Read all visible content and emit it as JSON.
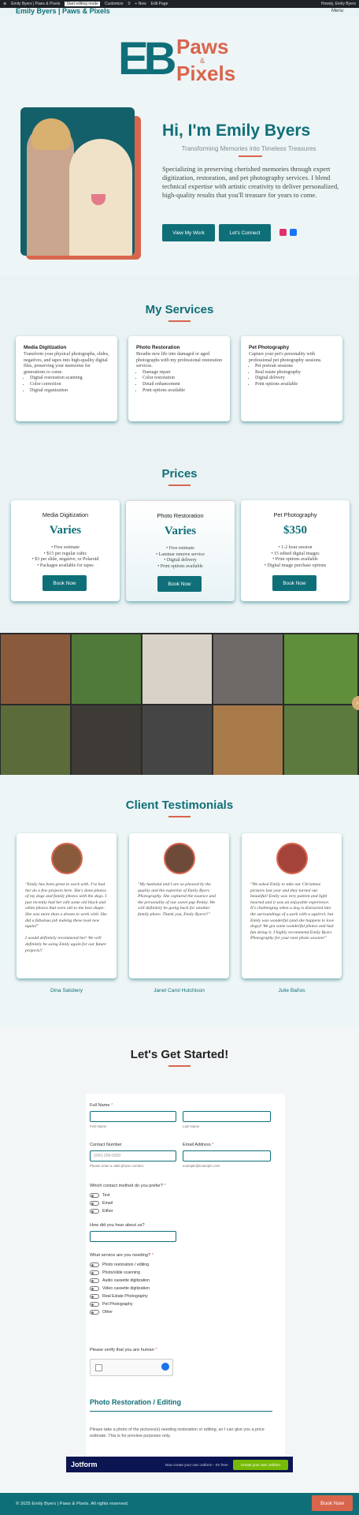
{
  "admin_bar": {
    "items": [
      "Emily Byers | Paws & Pixels",
      "Start editing mode",
      "Customize",
      "0",
      "+ New",
      "Edit Page"
    ],
    "account": "Howdy, Emily Byers"
  },
  "site": {
    "title": "Emily Byers | Paws & Pixels",
    "menu_label": "Menu"
  },
  "logo": {
    "initials": "EB",
    "word1": "Paws",
    "amp": "&",
    "word2": "Pixels"
  },
  "hero": {
    "heading": "Hi, I'm Emily Byers",
    "tagline": "Transforming Memories into Timeless Treasures",
    "intro": "Specializing in preserving cherished memories through expert digitization, restoration, and pet photography services. I blend technical expertise with artistic creativity to deliver personalized, high-quality results that you'll treasure for years to come.",
    "cta_primary": "View My Work",
    "cta_secondary": "Let's Connect",
    "social_icons": [
      "instagram-icon",
      "facebook-icon"
    ]
  },
  "services": {
    "title": "My Services",
    "cards": [
      {
        "name": "Media Digitization",
        "desc": "Transform your physical photographs, slides, negatives, and tapes into high-quality digital files, preserving your memories for generations to come.",
        "bullets": [
          "Digital restoration scanning",
          "Color correction",
          "Digital organization"
        ]
      },
      {
        "name": "Photo Restoration",
        "desc": "Breathe new life into damaged or aged photographs with my professional restoration services.",
        "bullets": [
          "Damage repair",
          "Color restoration",
          "Detail enhancement",
          "Print options available"
        ]
      },
      {
        "name": "Pet Photography",
        "desc": "Capture your pet's personality with professional pet photography sessions.",
        "bullets": [
          "Pet portrait sessions",
          "Real estate photography",
          "Digital delivery",
          "Print options available"
        ]
      }
    ]
  },
  "prices": {
    "title": "Prices",
    "cards": [
      {
        "name": "Media Digitization",
        "amount": "Varies",
        "bullets": [
          "Free estimate",
          "$15 per regular cubic",
          "$3 per slide, negative, or Polaroid",
          "Packages available for tapes"
        ],
        "button": "Book Now"
      },
      {
        "name": "Photo Restoration",
        "amount": "Varies",
        "bullets": [
          "Free estimate",
          "Laminar remove service",
          "Digital delivery",
          "Print options available"
        ],
        "button": "Book Now"
      },
      {
        "name": "Pet Photography",
        "amount": "$350",
        "bullets": [
          "1-2 hour session",
          "15 edited digital images",
          "Print options available",
          "Digital image purchase options"
        ],
        "button": "Book Now"
      }
    ]
  },
  "gallery": {
    "colors": [
      "#8a5a3c",
      "#4f7a3a",
      "#d9d2c8",
      "#6d6a68",
      "#5f8f3a",
      "#5c6b3a",
      "#3e3a36",
      "#454545",
      "#a87a4a",
      "#5c7a3e"
    ],
    "next_icon": "chevron-right-icon"
  },
  "testimonials": {
    "title": "Client Testimonials",
    "items": [
      {
        "quote": "\"Emily has been great to work with. I've had her do a few projects here. She's done photos of my dogs and family photos with the dogs. I just recently had her edit some old black and white photos that were old to the best shape. She was more than a dream to work with. She did a fabulous job making these look new again!\"",
        "note": "I would definitely recommend her! We will definitely be using Emily again for our future projects!!",
        "name": "Dina Salsbery"
      },
      {
        "quote": "\"My husband and I are so pleased by the quality and the expertise of Emily Byers Photography. She captured the essence and the personality of our sweet pup Penny. We will definitely be going back for another family photo. Thank you, Emily Byers!!\"",
        "note": "",
        "name": "Janet Carol Hutchison"
      },
      {
        "quote": "\"We asked Emily to take our Christmas pictures last year and they turned out beautiful! Emily was very patient and light hearted and it was an enjoyable experience. It's challenging when a dog is distracted into the surroundings of a park with a squirrel, but Emily was wonderful (and she happens to love dogs)! We got some wonderful photos and had fun doing it. I highly recommend Emily Byers Photography for your next photo session!\"",
        "note": "",
        "name": "Julie Baños"
      }
    ]
  },
  "form": {
    "title": "Let's Get Started!",
    "full_name_label": "Full Name",
    "first_name_sub": "First Name",
    "last_name_sub": "Last Name",
    "contact_label": "Contact Number",
    "contact_placeholder": "(000) 000-0000",
    "contact_sub": "Please enter a valid phone number.",
    "email_label": "Email Address",
    "email_sub": "example@example.com",
    "contact_method_label": "Which contact method do you prefer?",
    "contact_methods": [
      "Text",
      "Email",
      "Either"
    ],
    "heard_label": "How did you hear about us?",
    "service_label": "What service are you needing?",
    "services": [
      "Photo restoration / editing",
      "Photo/slide scanning",
      "Audio cassette digitization",
      "Video cassette digitization",
      "Real Estate Photography",
      "Pet Photography",
      "Other"
    ],
    "captcha_label": "Please verify that you are human",
    "section_heading": "Photo Restoration / Editing",
    "section_desc": "Please take a photo of the pictures(s) needing restoration or editing, so I can give you a price estimate. This is for preview purposes only."
  },
  "jotform": {
    "logo": "Jotform",
    "text": "Now create your own Jotform - It's free!",
    "button": "Create your own Jotform"
  },
  "footer": {
    "copyright": "© 2025 Emily Byers | Paws & Pixels. All rights reserved.",
    "button": "Book Now"
  },
  "colors": {
    "teal": "#0f6f78",
    "coral": "#d9654d"
  }
}
